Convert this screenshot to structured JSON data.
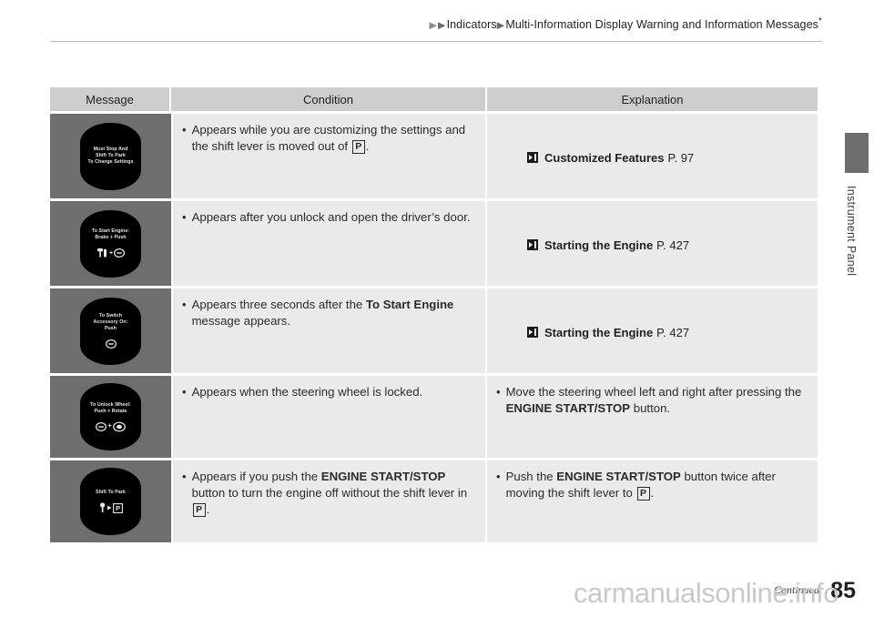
{
  "header": {
    "breadcrumb_arrow1": "▶",
    "breadcrumb_arrow2": "▶",
    "breadcrumb_item1": "Indicators",
    "breadcrumb_sep": "▶",
    "breadcrumb_item2": "Multi-Information Display Warning and Information Messages",
    "breadcrumb_star": "*"
  },
  "side_tab": {
    "label": "Instrument Panel"
  },
  "table": {
    "headers": {
      "message": "Message",
      "condition": "Condition",
      "explanation": "Explanation"
    },
    "rows": [
      {
        "display": {
          "lines": [
            "Must Stop And",
            "Shift To Park",
            "To Change Settings"
          ],
          "icons": []
        },
        "condition": {
          "bullet": "•",
          "text_before": "Appears while you are customizing the settings and the shift lever is moved out of ",
          "pbox": "P",
          "text_after": "."
        },
        "explanation": {
          "ref_icon": "reference-arrow-icon",
          "ref_title": "Customized Features",
          "ref_page": "P. 97"
        }
      },
      {
        "display": {
          "lines": [
            "To Start Engine:",
            "Brake + Push"
          ],
          "icons": [
            "brake-pedal-icon",
            "plus",
            "engine-start-stop-button-icon"
          ]
        },
        "condition": {
          "bullet": "•",
          "text_before": "Appears after you unlock and open the driver’s door.",
          "pbox": "",
          "text_after": ""
        },
        "explanation": {
          "ref_icon": "reference-arrow-icon",
          "ref_title": "Starting the Engine",
          "ref_page": "P. 427"
        }
      },
      {
        "display": {
          "lines": [
            "To Switch",
            "Accessory On:",
            "Push"
          ],
          "icons": [
            "engine-start-stop-button-icon"
          ]
        },
        "condition": {
          "bullet": "•",
          "text_before": "Appears three seconds after the ",
          "bold": "To Start Engine",
          "text_after": " message appears."
        },
        "explanation": {
          "ref_icon": "reference-arrow-icon",
          "ref_title": "Starting the Engine",
          "ref_page": "P. 427"
        }
      },
      {
        "display": {
          "lines": [
            "To Unlock Wheel:",
            "Push + Rotate"
          ],
          "icons": [
            "engine-start-stop-button-icon",
            "plus",
            "steering-wheel-icon"
          ]
        },
        "condition": {
          "bullet": "•",
          "text_before": "Appears when the steering wheel is locked.",
          "pbox": "",
          "text_after": ""
        },
        "explanation": {
          "bullet": "•",
          "text_before": "Move the steering wheel left and right after pressing the ",
          "bold": "ENGINE START/STOP",
          "text_after": " button."
        }
      },
      {
        "display": {
          "lines": [
            "Shift To Park"
          ],
          "icons": [
            "shift-lever-icon",
            "arrow",
            "park-position-icon"
          ]
        },
        "condition": {
          "bullet": "•",
          "text_before": "Appears if you push the ",
          "bold": "ENGINE START/STOP",
          "text_mid": " button to turn the engine off without the shift lever in ",
          "pbox": "P",
          "text_after": "."
        },
        "explanation": {
          "bullet": "•",
          "text_before": "Push the ",
          "bold": "ENGINE START/STOP",
          "text_mid": " button twice after moving the shift lever to ",
          "pbox": "P",
          "text_after": "."
        }
      }
    ]
  },
  "footer": {
    "continued": "Continued.",
    "page_number": "85",
    "watermark": "carmanualsonline.info"
  }
}
